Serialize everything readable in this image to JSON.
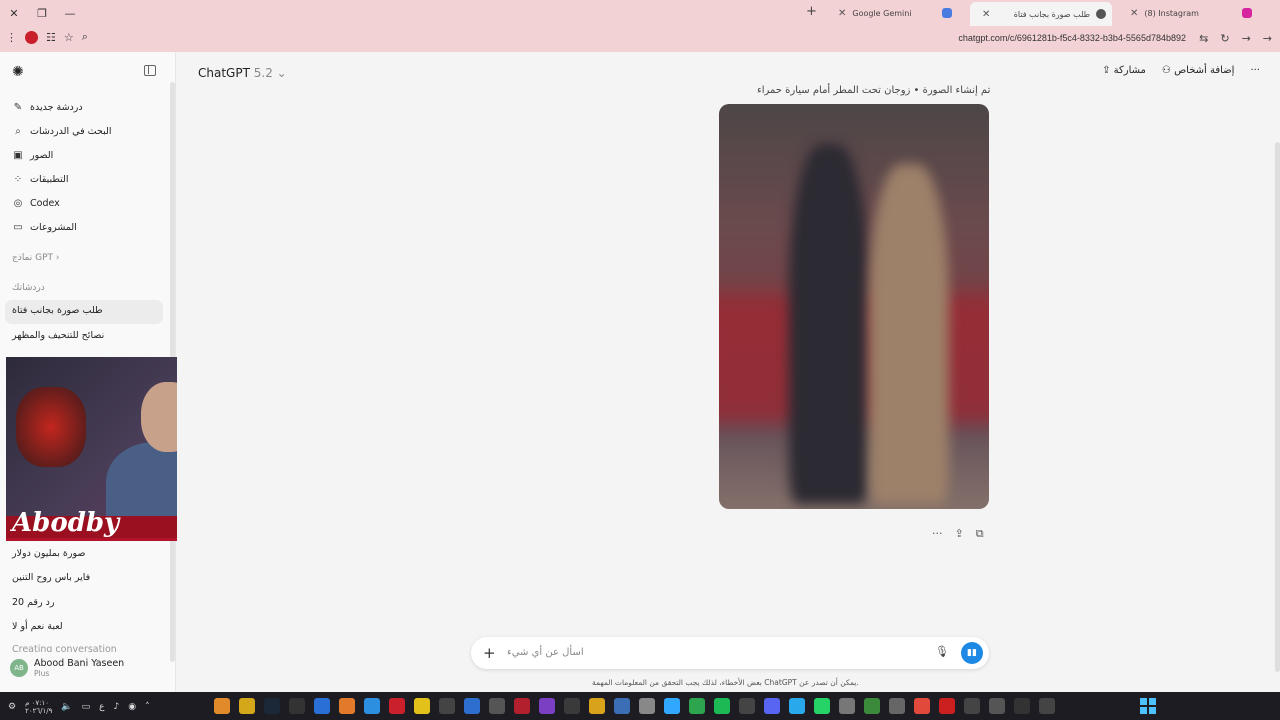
{
  "browser": {
    "tabs": [
      {
        "title": "Google Gemini",
        "active": false
      },
      {
        "title": "طلب صورة بجانب فتاة",
        "active": true
      },
      {
        "title": "(8) Instagram",
        "active": false
      }
    ],
    "url": "chatgpt.com/c/6961281b-f5c4-8332-b3b4-5565d784b892"
  },
  "sidebar": {
    "items": [
      {
        "label": "دردشة جديدة",
        "icon": "edit-icon"
      },
      {
        "label": "البحث في الدردشات",
        "icon": "search-icon"
      },
      {
        "label": "الصور",
        "icon": "images-icon"
      },
      {
        "label": "التطبيقات",
        "icon": "apps-icon"
      },
      {
        "label": "Codex",
        "icon": "codex-icon"
      },
      {
        "label": "المشروعات",
        "icon": "folder-icon"
      }
    ],
    "gpts_label": "نماذج GPT",
    "chats_label": "دردشاتك",
    "chats": [
      "طلب صورة بجانب فتاة",
      "نصائح للتنحيف والمظهر",
      "صورة بمليون دولار",
      "فاير باس روح التنين",
      "رد رقم 20",
      "لعبة نعم أو لا",
      "Creating conversation"
    ],
    "user": {
      "initials": "AB",
      "name": "Abood Bani Yaseen",
      "plan": "Plus"
    }
  },
  "webcam": {
    "brand": "Abodby"
  },
  "main": {
    "model_name": "ChatGPT",
    "model_version": "5.2",
    "share_label": "مشاركة",
    "add_people_label": "إضافة أشخاص",
    "image_caption": "تم إنشاء الصورة • زوجان تحت المطر أمام سيارة حمراء",
    "composer_placeholder": "اسأل عن أي شيء",
    "disclaimer": "بعض الأخطاء، لذلك يجب التحقق من المعلومات المهمة ChatGPT يمكن أن تصدر عن."
  },
  "taskbar": {
    "time": "٠٧:١٠ م",
    "date": "٢٠٢٦/١/٩",
    "lang": "ع"
  },
  "colors": {
    "accent": "#1e88e5",
    "tab_bg": "#f3d2d6",
    "taskbar": "#1c1c22"
  }
}
